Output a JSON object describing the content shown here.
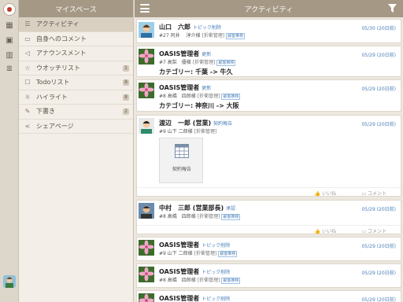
{
  "sidebar": {
    "title": "マイスペース",
    "items": [
      {
        "label": "アクティビティ",
        "icon": "list-icon",
        "badge": ""
      },
      {
        "label": "自身へのコメント",
        "icon": "comment-icon",
        "badge": ""
      },
      {
        "label": "アナウンスメント",
        "icon": "announcement-icon",
        "badge": ""
      },
      {
        "label": "ウオッチリスト",
        "icon": "star-icon",
        "badge": "1"
      },
      {
        "label": "Todoリスト",
        "icon": "checklist-icon",
        "badge": "8"
      },
      {
        "label": "ハイライト",
        "icon": "lightbulb-icon",
        "badge": "8"
      },
      {
        "label": "下書き",
        "icon": "pencil-icon",
        "badge": "2"
      },
      {
        "label": "シェアページ",
        "icon": "share-icon",
        "badge": ""
      }
    ]
  },
  "header": {
    "title": "アクティビティ"
  },
  "cards": [
    {
      "user": "山口　六郎",
      "action": "トピック削除",
      "sub": "#27 阿井　 淳介様",
      "tag": "[折衝管理]",
      "tag2": "顧客推移",
      "date": "05/30 (20日前)",
      "body": ""
    },
    {
      "user": "OASIS管理者",
      "action": "更新",
      "sub": "#7 高梨　優様",
      "tag": "[折衝管理]",
      "tag2": "顧客推移",
      "date": "05/29 (20日前)",
      "body": "カテゴリー: 千葉 -> 牛久"
    },
    {
      "user": "OASIS管理者",
      "action": "更新",
      "sub": "#8 高橋　四郎様",
      "tag": "[折衝管理]",
      "tag2": "顧客推移",
      "date": "05/29 (20日前)",
      "body": "カテゴリー: 神奈川 -> 大阪"
    },
    {
      "user": "渡辺　一郎 (営業)",
      "action": "契約報告",
      "sub": "#9 山下 二郎様",
      "tag": "[折衝管理]",
      "tag2": "",
      "date": "05/29 (20日前)",
      "body": "",
      "doc_label": "契約報告",
      "like": "いいね",
      "comment": "コメント"
    },
    {
      "user": "中村　三郎 (営業部長)",
      "action": "承認",
      "sub": "#8 高橋　四郎様",
      "tag": "[折衝管理]",
      "tag2": "顧客推移",
      "date": "05/29 (20日前)",
      "body": "",
      "like": "いいね",
      "comment": "コメント"
    },
    {
      "user": "OASIS管理者",
      "action": "トピック削除",
      "sub": "#9 山下 二郎様",
      "tag": "[折衝管理]",
      "tag2": "顧客推移",
      "date": "05/29 (20日前)",
      "body": ""
    },
    {
      "user": "OASIS管理者",
      "action": "トピック削除",
      "sub": "#8 高橋　四郎様",
      "tag": "[折衝管理]",
      "tag2": "顧客推移",
      "date": "05/29 (20日前)",
      "body": ""
    },
    {
      "user": "OASIS管理者",
      "action": "トピック削除",
      "sub": "",
      "tag": "",
      "tag2": "",
      "date": "05/29 (20日前)",
      "body": ""
    }
  ],
  "colors": {
    "header": "#a59885",
    "accent": "#4a7fb8",
    "rail": "#ddd6cb"
  }
}
